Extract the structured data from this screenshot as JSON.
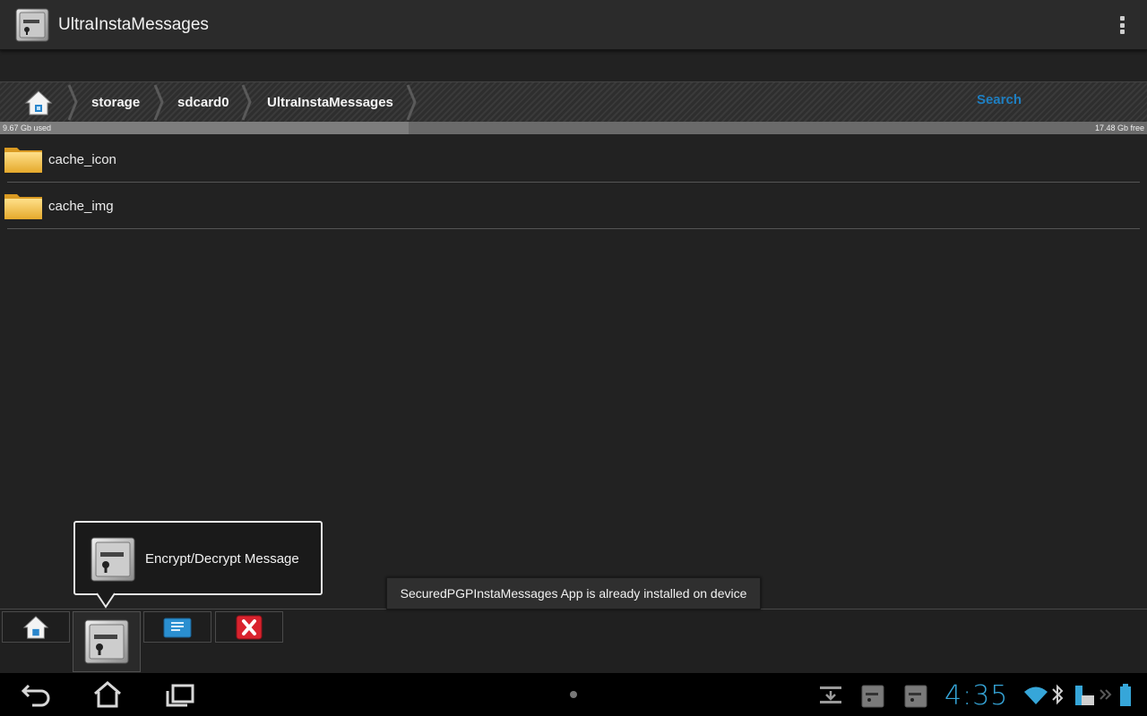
{
  "app": {
    "title": "UltraInstaMessages"
  },
  "breadcrumb": {
    "items": [
      {
        "label": "storage"
      },
      {
        "label": "sdcard0"
      },
      {
        "label": "UltraInstaMessages"
      }
    ],
    "search_label": "Search"
  },
  "storage": {
    "used_label": "9.67 Gb used",
    "free_label": "17.48 Gb free",
    "used_fraction": 0.356
  },
  "files": [
    {
      "name": "cache_icon"
    },
    {
      "name": "cache_img"
    }
  ],
  "popup": {
    "label": "Encrypt/Decrypt Message"
  },
  "toast": {
    "message": "SecuredPGPInstaMessages App is already installed on device"
  },
  "status": {
    "time": "4:35"
  },
  "colors": {
    "accent": "#36a6d9",
    "link": "#1e7fc2",
    "folder": "#f2c24a",
    "close": "#d9232e"
  }
}
